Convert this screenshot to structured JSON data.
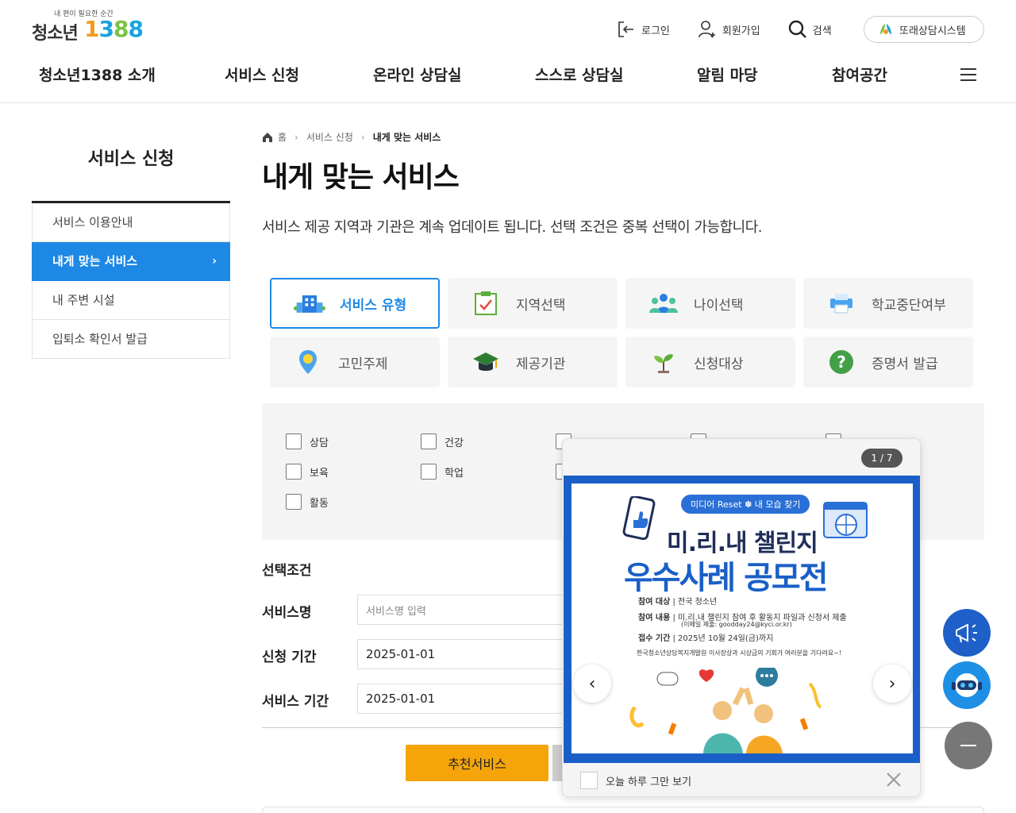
{
  "header": {
    "logo": {
      "tagline": "내 편이 필요한 순간",
      "brand": "청소년",
      "number": [
        "1",
        "3",
        "8",
        "8"
      ]
    },
    "utils": {
      "login": "로그인",
      "signup": "회원가입",
      "search": "검색",
      "counsel": "또래상담시스템"
    },
    "gnb": [
      "청소년1388 소개",
      "서비스 신청",
      "온라인 상담실",
      "스스로 상담실",
      "알림 마당",
      "참여공간"
    ]
  },
  "sidebar": {
    "title": "서비스 신청",
    "items": [
      {
        "label": "서비스 이용안내"
      },
      {
        "label": "내게 맞는 서비스"
      },
      {
        "label": "내 주변 시설"
      },
      {
        "label": "입퇴소 확인서 발급"
      }
    ],
    "active_chevron": "›"
  },
  "breadcrumb": {
    "home": "홈",
    "level1": "서비스 신청",
    "current": "내게 맞는 서비스"
  },
  "main": {
    "title": "내게 맞는 서비스",
    "description": "서비스 제공 지역과 기관은 계속 업데이트 됩니다. 선택 조건은 중복 선택이 가능합니다.",
    "tabs": [
      {
        "label": "서비스 유형",
        "icon": "building-icon"
      },
      {
        "label": "지역선택",
        "icon": "checklist-icon"
      },
      {
        "label": "나이선택",
        "icon": "people-icon"
      },
      {
        "label": "학교중단여부",
        "icon": "printer-icon"
      },
      {
        "label": "고민주제",
        "icon": "location-pin-icon"
      },
      {
        "label": "제공기관",
        "icon": "graduation-cap-icon"
      },
      {
        "label": "신청대상",
        "icon": "sprout-icon"
      },
      {
        "label": "증명서 발급",
        "icon": "question-icon"
      }
    ],
    "checkboxes": [
      {
        "label": "상담"
      },
      {
        "label": "건강"
      },
      {
        "label": "보육"
      },
      {
        "label": "학업"
      },
      {
        "label": "활동"
      }
    ],
    "form": {
      "conditions_label": "선택조건",
      "service_name_label": "서비스명",
      "service_name_placeholder": "서비스명 입력",
      "apply_period_label": "신청 기간",
      "apply_period_value": "2025-01-01",
      "service_period_label": "서비스 기간",
      "service_period_value": "2025-01-01"
    },
    "recommend_button": "추천서비스"
  },
  "popup": {
    "pager": "1 / 7",
    "poster": {
      "badge": "미디어 Reset ✽ 내 모습 찾기",
      "title1": "미.리.내 챌린지",
      "title2": "우수사례 공모전",
      "line1_label": "참여 대상",
      "line1_value": "전국 청소년",
      "line2_label": "참여 내용",
      "line2_value": "미.리.내 챌린지 참여 후 활동지 파일과 신청서 제출",
      "line2_note": "(이메일 제출: goodday24@kyci.or.kr)",
      "line3_label": "접수 기간",
      "line3_value": "2025년 10월 24일(금)까지",
      "footer": "한국청소년상담복지개발원 이사장상과 시상금의 기회가 여러분을 기다려요~!"
    },
    "today_only": "오늘 하루 그만 보기",
    "prev": "‹",
    "next": "›"
  },
  "colors": {
    "primary": "#1e88e5",
    "accent": "#f5a50a",
    "poster_blue": "#1a5fc7"
  }
}
